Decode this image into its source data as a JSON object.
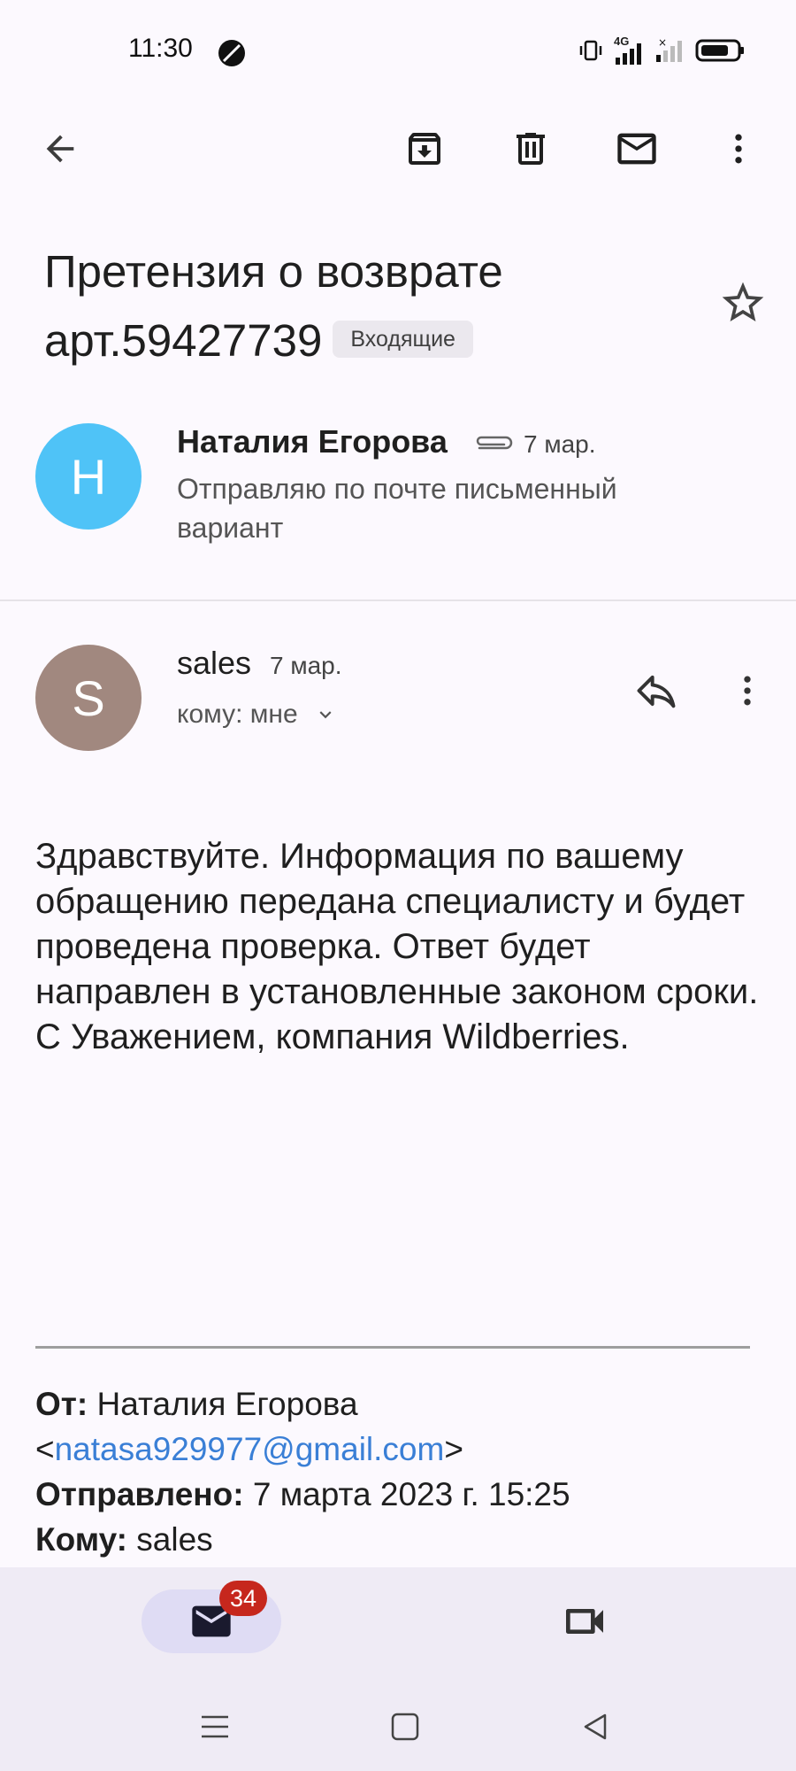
{
  "status_bar": {
    "time": "11:30",
    "network": "4G"
  },
  "toolbar": {
    "back_icon": "arrow-back-icon",
    "archive_icon": "archive-icon",
    "delete_icon": "delete-icon",
    "mark_unread_icon": "mail-icon",
    "more_icon": "more-vert-icon"
  },
  "email": {
    "subject": "Претензия о возврате арт.59427739",
    "label": "Входящие"
  },
  "messages": [
    {
      "avatar_letter": "Н",
      "avatar_color": "#4fc3f7",
      "sender": "Наталия Егорова",
      "date": "7 мар.",
      "snippet": "Отправляю по почте письменный вариант",
      "has_attachment": true
    },
    {
      "avatar_letter": "S",
      "avatar_color": "#a1887f",
      "sender": "sales",
      "date": "7 мар.",
      "to_label": "кому: мне",
      "body_lines": [
        "Здравствуйте. Информация по вашему обращению передана специалисту и будет проведена проверка. Ответ будет направлен в установленные законом сроки.",
        "С Уважением, компания Wildberries."
      ],
      "quoted": {
        "from_label": "От:",
        "from_name": "Наталия Егорова",
        "from_email": "natasa929977@gmail.com",
        "sent_label": "Отправлено:",
        "sent_value": "7 марта 2023 г. 15:25",
        "to_label": "Кому:",
        "to_value": "sales"
      }
    }
  ],
  "bottom_nav": {
    "mail_badge": "34",
    "mail_icon": "mail-icon",
    "meet_icon": "videocam-icon"
  },
  "colors": {
    "badge": "#c6271d",
    "link": "#3a7fd6",
    "active_tab": "#dfdcf4"
  }
}
